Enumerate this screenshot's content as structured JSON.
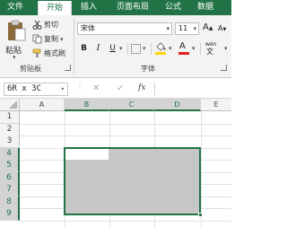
{
  "tabs": [
    {
      "label": "文件",
      "active": false
    },
    {
      "label": "开始",
      "active": true
    },
    {
      "label": "插入",
      "active": false
    },
    {
      "label": "页面布局",
      "active": false
    },
    {
      "label": "公式",
      "active": false
    },
    {
      "label": "数据",
      "active": false
    }
  ],
  "clipboard": {
    "paste_label": "粘贴",
    "cut_label": "剪切",
    "copy_label": "复制",
    "format_painter_label": "格式刷",
    "group_label": "剪贴板"
  },
  "font": {
    "family": "宋体",
    "size": "11",
    "bold": "B",
    "italic": "I",
    "underline": "U",
    "grow": "A",
    "shrink": "A",
    "group_label": "字体",
    "wen": "wén"
  },
  "formula_bar": {
    "name_box": "6R x 3C",
    "fx": "fx",
    "cancel": "✕",
    "confirm": "✓",
    "value": ""
  },
  "grid": {
    "columns": [
      "A",
      "B",
      "C",
      "D",
      "E"
    ],
    "rows": [
      "1",
      "2",
      "3",
      "4",
      "5",
      "6",
      "7",
      "8",
      "9"
    ],
    "selected_columns": [
      "B",
      "C",
      "D"
    ],
    "selected_rows": [
      "4",
      "5",
      "6",
      "7",
      "8",
      "9"
    ]
  },
  "colors": {
    "brand": "#217346",
    "selection_fill": "#c6c6c6",
    "paste_icon": "#8b6a3b",
    "font_color_bar": "#e02020",
    "fill_color_bar": "#ffd700"
  }
}
